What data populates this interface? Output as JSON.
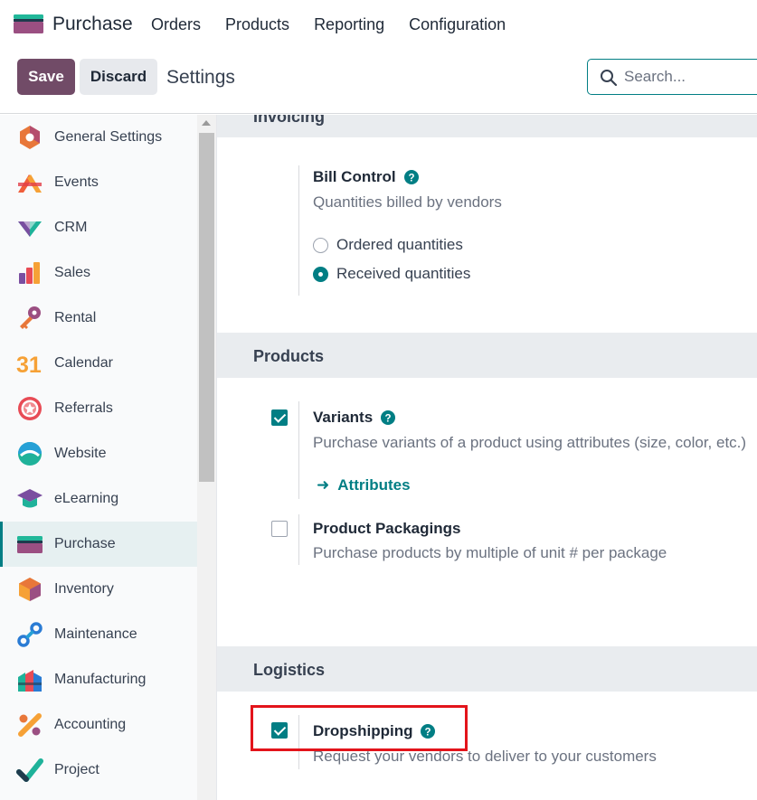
{
  "app": {
    "name": "Purchase"
  },
  "topnav": {
    "items": [
      "Orders",
      "Products",
      "Reporting",
      "Configuration"
    ]
  },
  "control": {
    "save_label": "Save",
    "discard_label": "Discard",
    "title": "Settings",
    "search_placeholder": "Search..."
  },
  "sidebar": {
    "items": [
      {
        "label": "General Settings",
        "icon": "general-settings-icon"
      },
      {
        "label": "Events",
        "icon": "events-icon"
      },
      {
        "label": "CRM",
        "icon": "crm-icon"
      },
      {
        "label": "Sales",
        "icon": "sales-icon"
      },
      {
        "label": "Rental",
        "icon": "rental-icon"
      },
      {
        "label": "Calendar",
        "icon": "calendar-icon"
      },
      {
        "label": "Referrals",
        "icon": "referrals-icon"
      },
      {
        "label": "Website",
        "icon": "website-icon"
      },
      {
        "label": "eLearning",
        "icon": "elearning-icon"
      },
      {
        "label": "Purchase",
        "icon": "purchase-icon",
        "active": true
      },
      {
        "label": "Inventory",
        "icon": "inventory-icon"
      },
      {
        "label": "Maintenance",
        "icon": "maintenance-icon"
      },
      {
        "label": "Manufacturing",
        "icon": "manufacturing-icon"
      },
      {
        "label": "Accounting",
        "icon": "accounting-icon"
      },
      {
        "label": "Project",
        "icon": "project-icon"
      }
    ],
    "calendar_icon_text": "31"
  },
  "invoicing": {
    "title": "Invoicing",
    "bill_control": {
      "title": "Bill Control",
      "description": "Quantities billed by vendors",
      "options": [
        {
          "label": "Ordered quantities",
          "checked": false
        },
        {
          "label": "Received quantities",
          "checked": true
        }
      ]
    }
  },
  "products": {
    "title": "Products",
    "variants": {
      "title": "Variants",
      "description": "Purchase variants of a product using attributes (size, color, etc.)",
      "checked": true,
      "link": "Attributes"
    },
    "packagings": {
      "title": "Product Packagings",
      "description": "Purchase products by multiple of unit # per package",
      "checked": false
    }
  },
  "logistics": {
    "title": "Logistics",
    "dropshipping": {
      "title": "Dropshipping",
      "description": "Request your vendors to deliver to your customers",
      "checked": true
    }
  },
  "colors": {
    "primary": "#714b67",
    "accent": "#017e84",
    "highlight": "#e3141b"
  }
}
